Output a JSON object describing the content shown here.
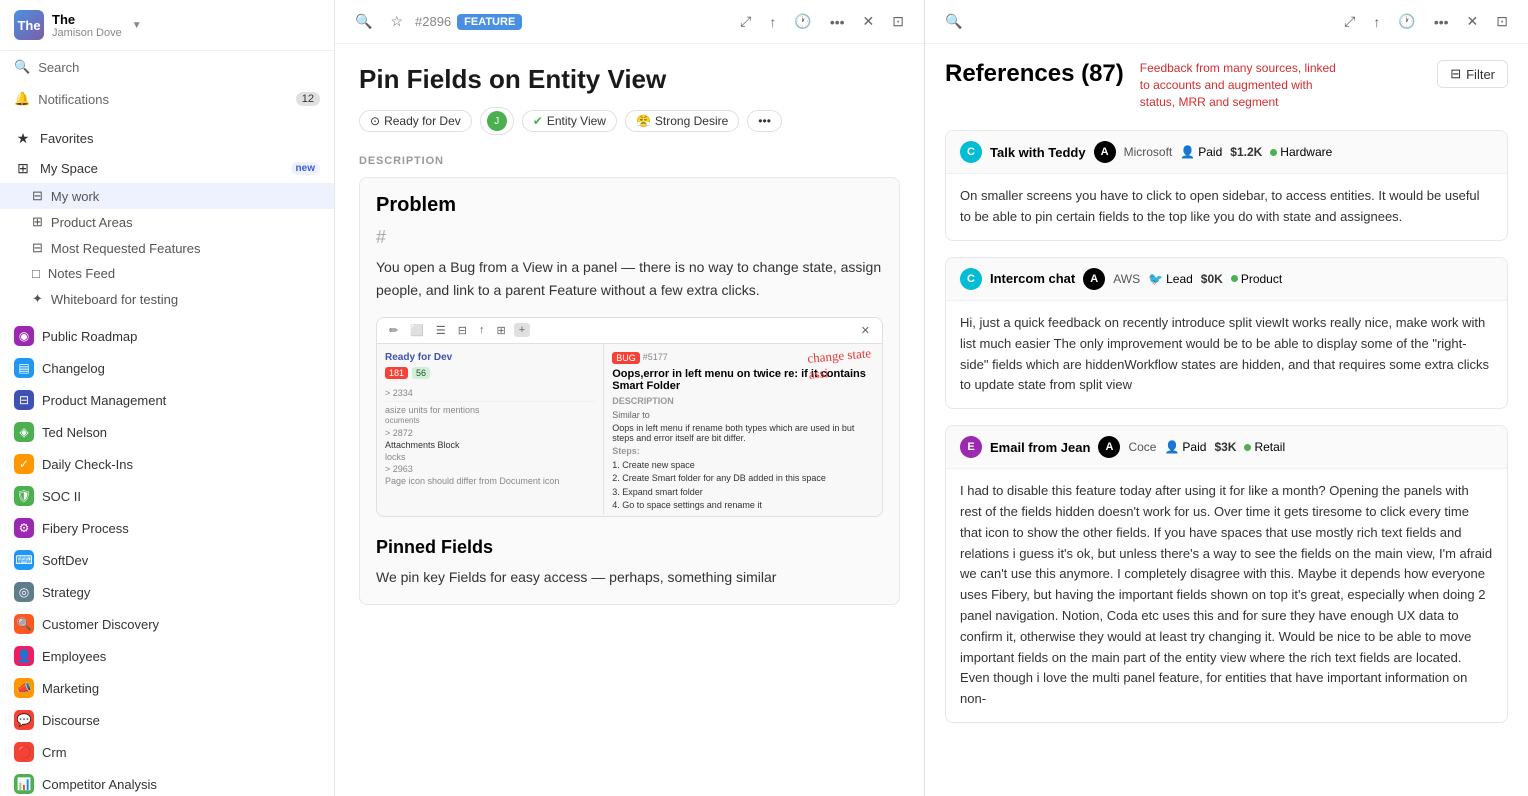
{
  "sidebar": {
    "logo_text": "The",
    "workspace_name": "The",
    "workspace_user": "Jamison Dove",
    "search_label": "Search",
    "notifications_label": "Notifications",
    "notifications_count": "12",
    "sections": {
      "top": [
        {
          "id": "favorites",
          "label": "Favorites",
          "icon": "★"
        },
        {
          "id": "my-space",
          "label": "My Space",
          "icon": "⊞",
          "badge": "new"
        },
        {
          "id": "my-work",
          "label": "My work",
          "icon": "⊟",
          "indent": true,
          "active": true
        },
        {
          "id": "product-areas",
          "label": "Product Areas",
          "icon": "⊞",
          "indent": true
        },
        {
          "id": "most-requested",
          "label": "Most Requested Features",
          "icon": "⊟",
          "indent": true
        },
        {
          "id": "notes-feed",
          "label": "Notes Feed",
          "icon": "□",
          "indent": true
        },
        {
          "id": "whiteboard",
          "label": "Whiteboard for testing",
          "icon": "✦",
          "indent": true
        }
      ],
      "apps": [
        {
          "id": "public-roadmap",
          "label": "Public Roadmap",
          "color": "#9c27b0"
        },
        {
          "id": "changelog",
          "label": "Changelog",
          "color": "#2196f3"
        },
        {
          "id": "product-management",
          "label": "Product Management",
          "color": "#3f51b5"
        },
        {
          "id": "ted-nelson",
          "label": "Ted Nelson",
          "color": "#4caf50"
        },
        {
          "id": "daily-checkins",
          "label": "Daily Check-Ins",
          "color": "#ff9800"
        },
        {
          "id": "soc-ii",
          "label": "SOC II",
          "color": "#4caf50"
        },
        {
          "id": "fibery-process",
          "label": "Fibery Process",
          "color": "#9c27b0"
        },
        {
          "id": "softdev",
          "label": "SoftDev",
          "color": "#2196f3"
        },
        {
          "id": "strategy",
          "label": "Strategy",
          "color": "#607d8b"
        },
        {
          "id": "customer-discovery",
          "label": "Customer Discovery",
          "color": "#ff5722"
        },
        {
          "id": "employees",
          "label": "Employees",
          "color": "#e91e63"
        },
        {
          "id": "marketing",
          "label": "Marketing",
          "color": "#ff9800"
        },
        {
          "id": "discourse",
          "label": "Discourse",
          "color": "#f44336"
        },
        {
          "id": "crm",
          "label": "Crm",
          "color": "#f44336"
        },
        {
          "id": "competitor-analysis",
          "label": "Competitor Analysis",
          "color": "#4caf50"
        }
      ]
    }
  },
  "panel_left": {
    "item_id": "#2896",
    "feature_badge": "FEATURE",
    "title": "Pin Fields on Entity View",
    "tags": [
      {
        "label": "Ready for Dev",
        "dot_color": "#9c27b0",
        "icon": "⊙"
      },
      {
        "label": "Entity View",
        "dot_color": "#4caf50",
        "icon": "✔"
      },
      {
        "label": "Strong Desire",
        "dot_color": "#e91e63",
        "icon": "😤"
      }
    ],
    "description_label": "DESCRIPTION",
    "problem_title": "Problem",
    "problem_hash": "#",
    "problem_text": "You open a Bug from a View in a panel — there is no way to change state, assign people, and link to a parent Feature without a few extra clicks.",
    "screenshot_annotation": "change state assi",
    "pinned_title": "Pinned Fields",
    "pinned_text": "We pin key Fields for easy access — perhaps, something similar"
  },
  "panel_right": {
    "references_title": "References (87)",
    "references_subtitle": "Feedback from many sources, linked to accounts and augmented with status, MRR and segment",
    "filter_label": "Filter",
    "references": [
      {
        "id": "ref1",
        "avatar_letter": "C",
        "avatar_color": "#00bcd4",
        "source_name": "Talk with Teddy",
        "company_letter": "A",
        "company_color": "#000",
        "company": "Microsoft",
        "tier_icon": "👤",
        "tier": "Paid",
        "mrr": "$1.2K",
        "segment_dot": true,
        "segment": "Hardware",
        "body": "On smaller screens you have to click to open sidebar, to access entities. It would be useful to be able to pin certain fields to the top like you do with state and assignees."
      },
      {
        "id": "ref2",
        "avatar_letter": "C",
        "avatar_color": "#00bcd4",
        "source_name": "Intercom chat",
        "company_letter": "A",
        "company_color": "#000",
        "company": "AWS",
        "tier_icon": "🐦",
        "tier": "Lead",
        "mrr": "$0K",
        "segment_dot": true,
        "segment": "Product",
        "body": "Hi, just a quick feedback on recently introduce split viewIt works really nice, make work with list much easier\nThe only improvement would be to be able to display some of the \"right-side\" fields which are hiddenWorkflow states are hidden, and that requires some extra clicks to update state from split view"
      },
      {
        "id": "ref3",
        "avatar_letter": "E",
        "avatar_color": "#9c27b0",
        "source_name": "Email from Jean",
        "company_letter": "A",
        "company_color": "#000",
        "company": "Coce",
        "tier_icon": "👤",
        "tier": "Paid",
        "mrr": "$3K",
        "segment_dot": true,
        "segment": "Retail",
        "body": "I had to disable this feature today after using it for like a month?\nOpening the panels with rest of the fields hidden doesn't work for us. Over time it gets tiresome to click every time that icon to show the other fields. If you have spaces that use mostly rich text fields and relations i guess it's ok, but unless there's a way to see the fields on the main view, I'm afraid we can't use this anymore.\n\nI completely disagree with this. Maybe it depends how everyone uses Fibery, but having the important fields shown on top it's great, especially when doing 2 panel navigation. Notion, Coda etc uses this and for sure they have enough UX data to confirm it, otherwise they would at least try changing it.\n\nWould be nice to be able to move important fields on the main part of the entity view where the rich text fields are located. Even though i love the multi panel feature, for entities that have important information on non-"
      }
    ]
  }
}
